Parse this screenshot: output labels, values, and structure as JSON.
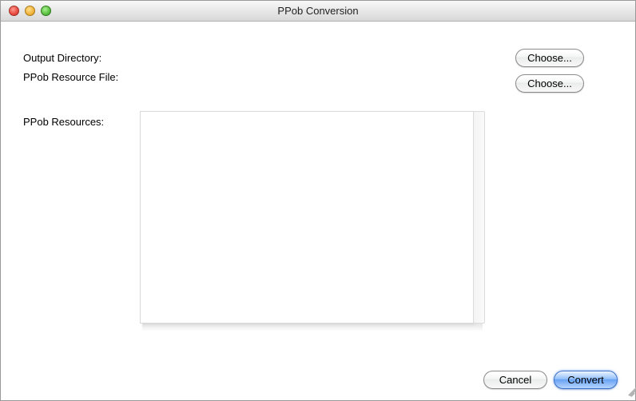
{
  "window": {
    "title": "PPob Conversion"
  },
  "labels": {
    "output_directory": "Output Directory:",
    "ppob_resource_file": "PPob Resource File:",
    "ppob_resources": "PPob Resources:"
  },
  "buttons": {
    "choose_output": "Choose...",
    "choose_resource": "Choose...",
    "cancel": "Cancel",
    "convert": "Convert"
  },
  "fields": {
    "output_directory_value": "",
    "ppob_resource_file_value": ""
  },
  "resources_list": []
}
